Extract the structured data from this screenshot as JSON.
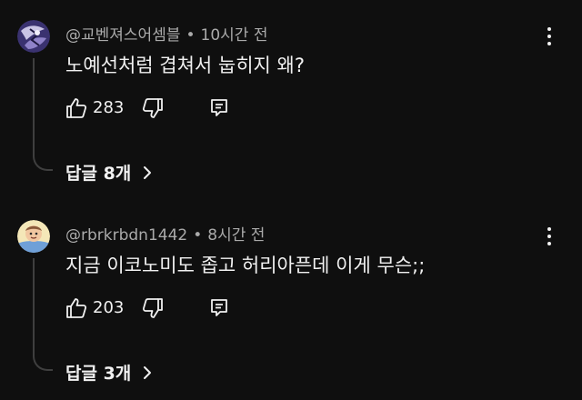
{
  "comments": [
    {
      "author": "@교벤져스어셈블",
      "separator": "•",
      "time": "10시간 전",
      "text": "노예선처럼 겹쳐서 눕히지 왜?",
      "likes": "283",
      "replies_label": "답글 8개",
      "avatar_icon": "avatar-purple-pattern-icon"
    },
    {
      "author": "@rbrkrbdn1442",
      "separator": "•",
      "time": "8시간 전",
      "text": "지금 이코노미도 좁고 허리아픈데 이게 무슨;;",
      "likes": "203",
      "replies_label": "답글 3개",
      "avatar_icon": "avatar-cartoon-character-icon"
    }
  ],
  "icons": {
    "like": "thumbs-up-icon",
    "dislike": "thumbs-down-icon",
    "reply": "reply-comment-icon",
    "more": "more-vertical-icon",
    "chevron": "chevron-right-icon"
  },
  "colors": {
    "background": "#0f0f0f",
    "text": "#f1f1f1",
    "meta": "#aaaaaa",
    "thread_line": "#3f3f3f"
  }
}
